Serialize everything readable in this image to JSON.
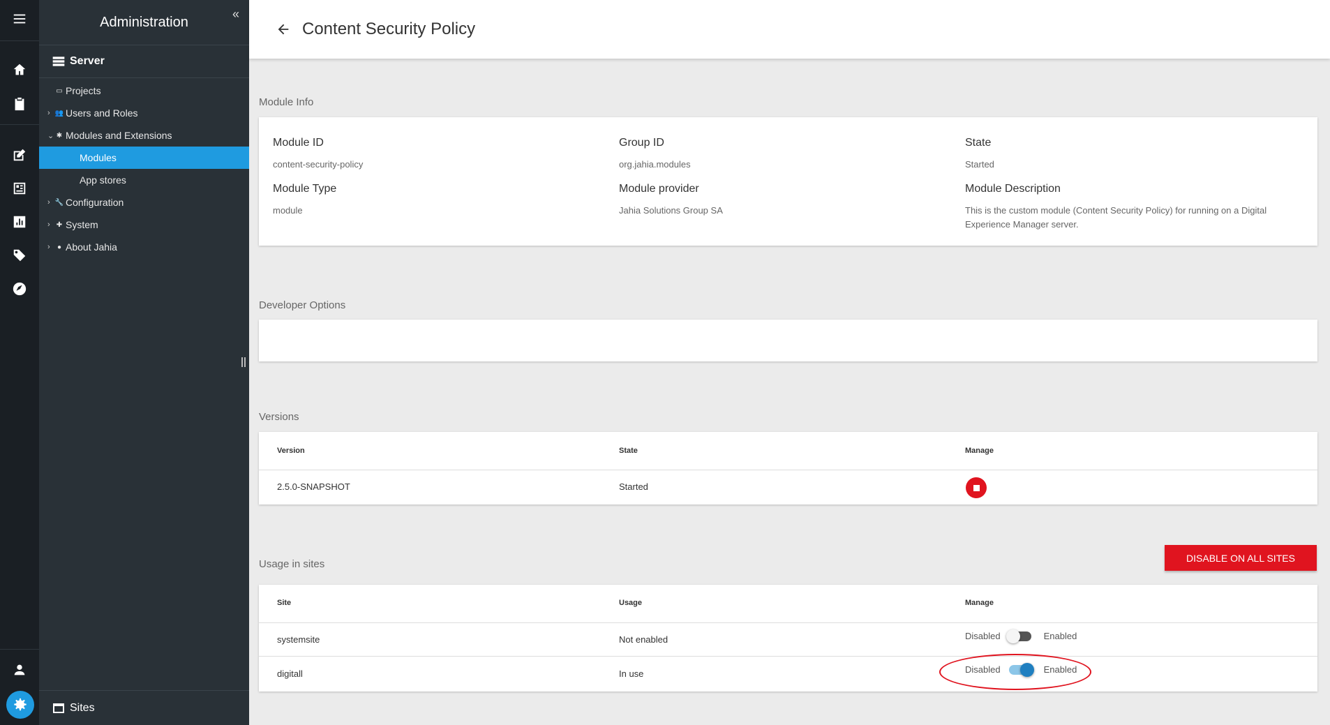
{
  "sidebar": {
    "title": "Administration",
    "collapse": "«",
    "section": "Server",
    "items": [
      {
        "label": "Projects",
        "icon": "projects-icon",
        "chev": "",
        "glyph": "▭"
      },
      {
        "label": "Users and Roles",
        "icon": "users-icon",
        "chev": "›",
        "glyph": "👥"
      },
      {
        "label": "Modules and Extensions",
        "icon": "puzzle-icon",
        "chev": "⌄",
        "glyph": "✱"
      },
      {
        "label": "Modules",
        "icon": "",
        "chev": "",
        "glyph": ""
      },
      {
        "label": "App stores",
        "icon": "",
        "chev": "",
        "glyph": ""
      },
      {
        "label": "Configuration",
        "icon": "wrench-icon",
        "chev": "›",
        "glyph": "🔧"
      },
      {
        "label": "System",
        "icon": "plus-icon",
        "chev": "›",
        "glyph": "✚"
      },
      {
        "label": "About Jahia",
        "icon": "info-icon",
        "chev": "›",
        "glyph": "●"
      }
    ],
    "footer": "Sites"
  },
  "header": {
    "title": "Content Security Policy"
  },
  "module_info": {
    "label": "Module Info",
    "module_id_label": "Module ID",
    "module_id": "content-security-policy",
    "group_id_label": "Group ID",
    "group_id": "org.jahia.modules",
    "state_label": "State",
    "state": "Started",
    "type_label": "Module Type",
    "type": "module",
    "provider_label": "Module provider",
    "provider": "Jahia Solutions Group SA",
    "description_label": "Module Description",
    "description": "This is the custom module (Content Security Policy) for running on a Digital Experience Manager server."
  },
  "developer_options": {
    "label": "Developer Options"
  },
  "versions": {
    "label": "Versions",
    "headers": [
      "Version",
      "State",
      "Manage"
    ],
    "rows": [
      {
        "version": "2.5.0-SNAPSHOT",
        "state": "Started"
      }
    ]
  },
  "usage": {
    "label": "Usage in sites",
    "disable_all": "DISABLE ON ALL SITES",
    "headers": [
      "Site",
      "Usage",
      "Manage"
    ],
    "disabled_label": "Disabled",
    "enabled_label": "Enabled",
    "rows": [
      {
        "site": "systemsite",
        "usage": "Not enabled",
        "enabled": false
      },
      {
        "site": "digitall",
        "usage": "In use",
        "enabled": true
      }
    ]
  }
}
